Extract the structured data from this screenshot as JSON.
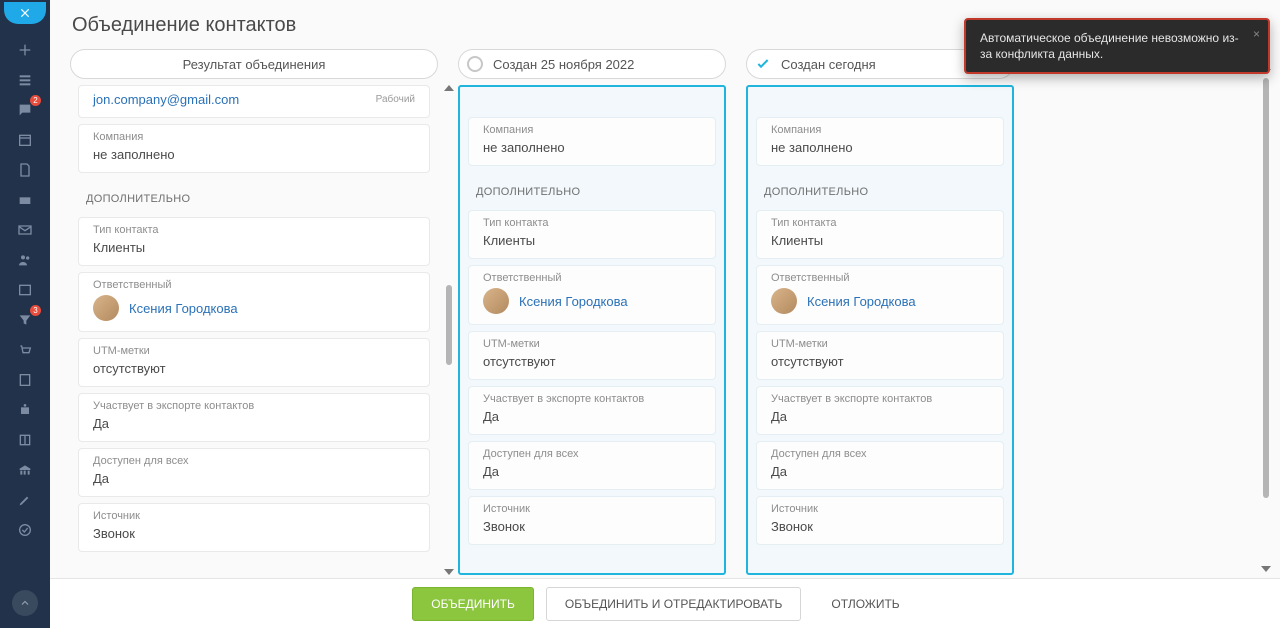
{
  "page_title": "Объединение контактов",
  "toast": {
    "message": "Автоматическое объединение невозможно из-за конфликта данных.",
    "close": "×"
  },
  "columns": {
    "result": {
      "header": "Результат объединения",
      "email_value": "jon.company@gmail.com",
      "email_type": "Рабочий"
    },
    "source1": {
      "header": "Создан 25 ноября 2022"
    },
    "source2": {
      "header": "Создан сегодня"
    }
  },
  "labels": {
    "company": "Компания",
    "not_filled": "не заполнено",
    "additional": "ДОПОЛНИТЕЛЬНО",
    "contact_type": "Тип контакта",
    "clients": "Клиенты",
    "responsible": "Ответственный",
    "utm": "UTM-метки",
    "absent": "отсутствуют",
    "export": "Участвует в экспорте контактов",
    "yes": "Да",
    "public": "Доступен для всех",
    "source": "Источник",
    "source_val": "Звонок",
    "merge_result": "Результат объединения"
  },
  "manager": {
    "name": "Ксения Городкова"
  },
  "nav": {
    "badge2": "2",
    "badge3": "3"
  },
  "footer": {
    "merge": "ОБЪЕДИНИТЬ",
    "merge_edit": "ОБЪЕДИНИТЬ И ОТРЕДАКТИРОВАТЬ",
    "postpone": "ОТЛОЖИТЬ"
  }
}
